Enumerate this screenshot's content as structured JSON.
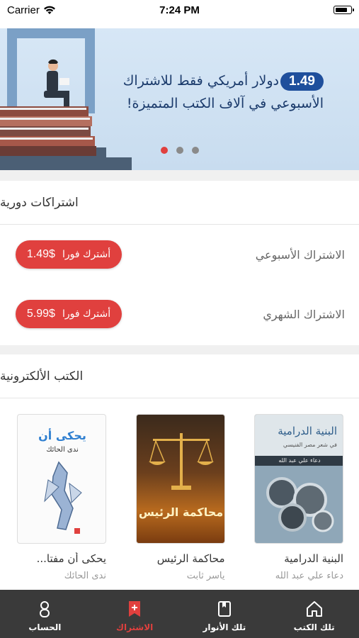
{
  "status_bar": {
    "carrier": "Carrier",
    "time": "7:24 PM"
  },
  "banner": {
    "price": "1.49",
    "line1": "دولار أمريكي فقط للاشتراك",
    "line2": "الأسبوعي في آلاف الكتب المتميزة!",
    "active_slide": 1,
    "slide_count": 3
  },
  "subscriptions": {
    "title": "اشتراكات دورية",
    "rows": [
      {
        "label": "الاشتراك الأسبوعي",
        "button": "أشترك فورا",
        "price": "1.49$"
      },
      {
        "label": "الاشتراك الشهري",
        "button": "أشترك فورا",
        "price": "5.99$"
      }
    ]
  },
  "ebooks": {
    "title": "الكتب الألكترونية",
    "items": [
      {
        "title": "البنية الدرامية",
        "author": "دعاء علي عبد الله",
        "cover_title": "البنية الدرامية",
        "cover_subtitle": "في شعر مصر الفنيسي",
        "cover_author": "دعاء علي عبد الله"
      },
      {
        "title": "محاكمة الرئيس",
        "author": "ياسر ثابت",
        "cover_title": "محاكمة الرئيس"
      },
      {
        "title": "يحكى أن مفتا...",
        "author": "ندى الحائك",
        "cover_title": "يحكى أن",
        "cover_subtitle": "ندى الحائك"
      }
    ]
  },
  "tabbar": {
    "items": [
      {
        "label": "تلك الكتب",
        "icon": "home-icon"
      },
      {
        "label": "تلك الأنوار",
        "icon": "book-icon"
      },
      {
        "label": "الاشتراك",
        "icon": "bookmark-plus-icon",
        "active": true
      },
      {
        "label": "الحساب",
        "icon": "person-icon"
      }
    ]
  },
  "colors": {
    "accent": "#e0403e",
    "banner_text": "#1a3a6b",
    "tabbar_bg": "#3a3a3a"
  }
}
